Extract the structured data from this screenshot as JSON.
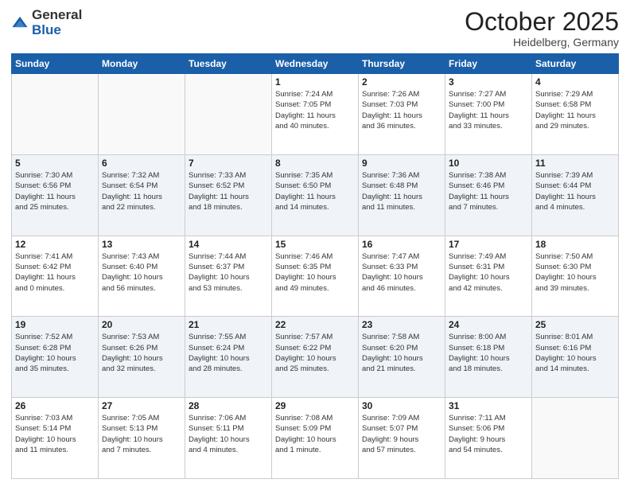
{
  "header": {
    "logo": {
      "line1": "General",
      "line2": "Blue"
    },
    "title": "October 2025",
    "subtitle": "Heidelberg, Germany"
  },
  "weekdays": [
    "Sunday",
    "Monday",
    "Tuesday",
    "Wednesday",
    "Thursday",
    "Friday",
    "Saturday"
  ],
  "weeks": [
    [
      {
        "day": "",
        "info": ""
      },
      {
        "day": "",
        "info": ""
      },
      {
        "day": "",
        "info": ""
      },
      {
        "day": "1",
        "info": "Sunrise: 7:24 AM\nSunset: 7:05 PM\nDaylight: 11 hours\nand 40 minutes."
      },
      {
        "day": "2",
        "info": "Sunrise: 7:26 AM\nSunset: 7:03 PM\nDaylight: 11 hours\nand 36 minutes."
      },
      {
        "day": "3",
        "info": "Sunrise: 7:27 AM\nSunset: 7:00 PM\nDaylight: 11 hours\nand 33 minutes."
      },
      {
        "day": "4",
        "info": "Sunrise: 7:29 AM\nSunset: 6:58 PM\nDaylight: 11 hours\nand 29 minutes."
      }
    ],
    [
      {
        "day": "5",
        "info": "Sunrise: 7:30 AM\nSunset: 6:56 PM\nDaylight: 11 hours\nand 25 minutes."
      },
      {
        "day": "6",
        "info": "Sunrise: 7:32 AM\nSunset: 6:54 PM\nDaylight: 11 hours\nand 22 minutes."
      },
      {
        "day": "7",
        "info": "Sunrise: 7:33 AM\nSunset: 6:52 PM\nDaylight: 11 hours\nand 18 minutes."
      },
      {
        "day": "8",
        "info": "Sunrise: 7:35 AM\nSunset: 6:50 PM\nDaylight: 11 hours\nand 14 minutes."
      },
      {
        "day": "9",
        "info": "Sunrise: 7:36 AM\nSunset: 6:48 PM\nDaylight: 11 hours\nand 11 minutes."
      },
      {
        "day": "10",
        "info": "Sunrise: 7:38 AM\nSunset: 6:46 PM\nDaylight: 11 hours\nand 7 minutes."
      },
      {
        "day": "11",
        "info": "Sunrise: 7:39 AM\nSunset: 6:44 PM\nDaylight: 11 hours\nand 4 minutes."
      }
    ],
    [
      {
        "day": "12",
        "info": "Sunrise: 7:41 AM\nSunset: 6:42 PM\nDaylight: 11 hours\nand 0 minutes."
      },
      {
        "day": "13",
        "info": "Sunrise: 7:43 AM\nSunset: 6:40 PM\nDaylight: 10 hours\nand 56 minutes."
      },
      {
        "day": "14",
        "info": "Sunrise: 7:44 AM\nSunset: 6:37 PM\nDaylight: 10 hours\nand 53 minutes."
      },
      {
        "day": "15",
        "info": "Sunrise: 7:46 AM\nSunset: 6:35 PM\nDaylight: 10 hours\nand 49 minutes."
      },
      {
        "day": "16",
        "info": "Sunrise: 7:47 AM\nSunset: 6:33 PM\nDaylight: 10 hours\nand 46 minutes."
      },
      {
        "day": "17",
        "info": "Sunrise: 7:49 AM\nSunset: 6:31 PM\nDaylight: 10 hours\nand 42 minutes."
      },
      {
        "day": "18",
        "info": "Sunrise: 7:50 AM\nSunset: 6:30 PM\nDaylight: 10 hours\nand 39 minutes."
      }
    ],
    [
      {
        "day": "19",
        "info": "Sunrise: 7:52 AM\nSunset: 6:28 PM\nDaylight: 10 hours\nand 35 minutes."
      },
      {
        "day": "20",
        "info": "Sunrise: 7:53 AM\nSunset: 6:26 PM\nDaylight: 10 hours\nand 32 minutes."
      },
      {
        "day": "21",
        "info": "Sunrise: 7:55 AM\nSunset: 6:24 PM\nDaylight: 10 hours\nand 28 minutes."
      },
      {
        "day": "22",
        "info": "Sunrise: 7:57 AM\nSunset: 6:22 PM\nDaylight: 10 hours\nand 25 minutes."
      },
      {
        "day": "23",
        "info": "Sunrise: 7:58 AM\nSunset: 6:20 PM\nDaylight: 10 hours\nand 21 minutes."
      },
      {
        "day": "24",
        "info": "Sunrise: 8:00 AM\nSunset: 6:18 PM\nDaylight: 10 hours\nand 18 minutes."
      },
      {
        "day": "25",
        "info": "Sunrise: 8:01 AM\nSunset: 6:16 PM\nDaylight: 10 hours\nand 14 minutes."
      }
    ],
    [
      {
        "day": "26",
        "info": "Sunrise: 7:03 AM\nSunset: 5:14 PM\nDaylight: 10 hours\nand 11 minutes."
      },
      {
        "day": "27",
        "info": "Sunrise: 7:05 AM\nSunset: 5:13 PM\nDaylight: 10 hours\nand 7 minutes."
      },
      {
        "day": "28",
        "info": "Sunrise: 7:06 AM\nSunset: 5:11 PM\nDaylight: 10 hours\nand 4 minutes."
      },
      {
        "day": "29",
        "info": "Sunrise: 7:08 AM\nSunset: 5:09 PM\nDaylight: 10 hours\nand 1 minute."
      },
      {
        "day": "30",
        "info": "Sunrise: 7:09 AM\nSunset: 5:07 PM\nDaylight: 9 hours\nand 57 minutes."
      },
      {
        "day": "31",
        "info": "Sunrise: 7:11 AM\nSunset: 5:06 PM\nDaylight: 9 hours\nand 54 minutes."
      },
      {
        "day": "",
        "info": ""
      }
    ]
  ]
}
